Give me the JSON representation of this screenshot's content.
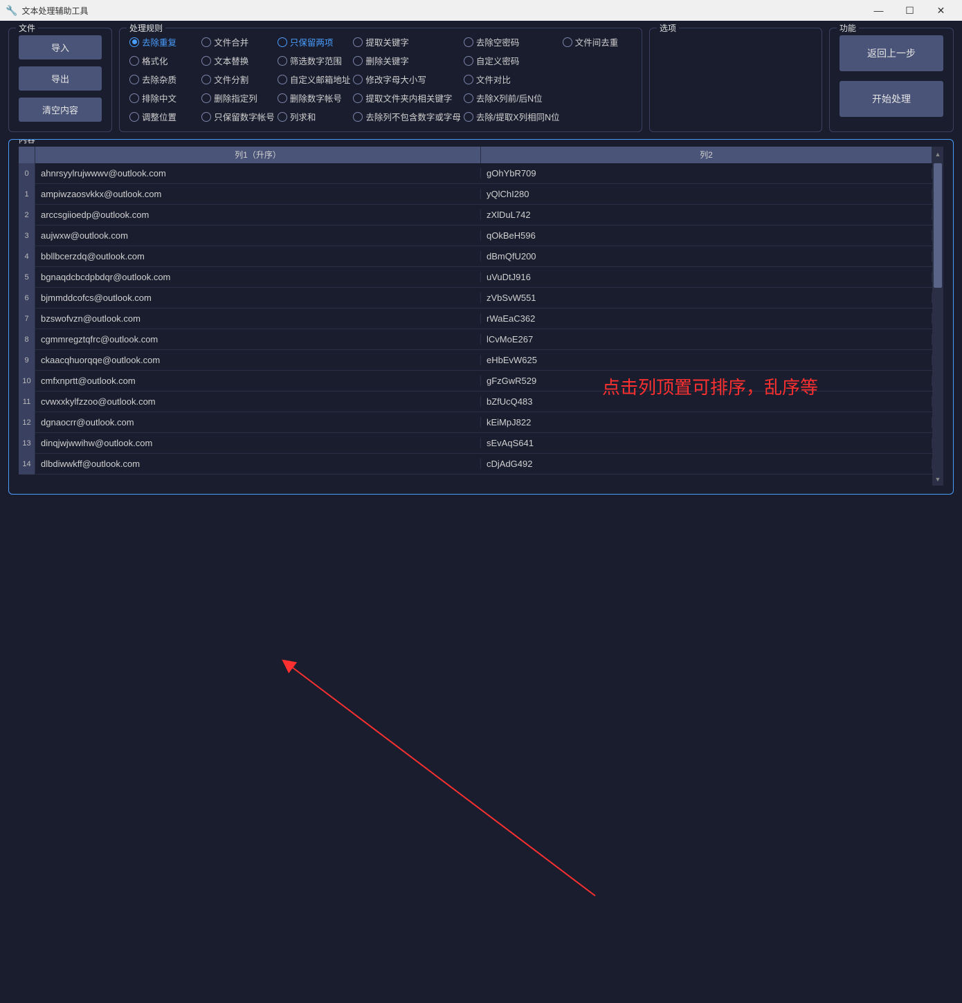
{
  "window": {
    "title": "文本处理辅助工具"
  },
  "file": {
    "title": "文件",
    "import": "导入",
    "export": "导出",
    "clear": "清空内容"
  },
  "rules": {
    "title": "处理规则",
    "options": [
      {
        "label": "去除重复",
        "selected": true
      },
      {
        "label": "文件合并"
      },
      {
        "label": "只保留两项",
        "highlight": true
      },
      {
        "label": "提取关键字"
      },
      {
        "label": "去除空密码"
      },
      {
        "label": "文件间去重"
      },
      {
        "label": "格式化"
      },
      {
        "label": "文本替换"
      },
      {
        "label": "筛选数字范围"
      },
      {
        "label": "删除关键字"
      },
      {
        "label": "自定义密码"
      },
      {
        "label": ""
      },
      {
        "label": "去除杂质"
      },
      {
        "label": "文件分割"
      },
      {
        "label": "自定义邮箱地址"
      },
      {
        "label": "修改字母大小写"
      },
      {
        "label": "文件对比"
      },
      {
        "label": ""
      },
      {
        "label": "排除中文"
      },
      {
        "label": "删除指定列"
      },
      {
        "label": "删除数字帐号"
      },
      {
        "label": "提取文件夹内相关键字"
      },
      {
        "label": "去除X列前/后N位"
      },
      {
        "label": ""
      },
      {
        "label": "调整位置"
      },
      {
        "label": "只保留数字帐号"
      },
      {
        "label": "列求和"
      },
      {
        "label": "去除列不包含数字或字母"
      },
      {
        "label": "去除/提取X列相同N位"
      },
      {
        "label": ""
      }
    ]
  },
  "options_group": {
    "title": "选项"
  },
  "func": {
    "title": "功能",
    "back": "返回上一步",
    "start": "开始处理"
  },
  "content": {
    "title": "内容",
    "col1": "列1（升序）",
    "col2": "列2",
    "rows": [
      {
        "c1": "ahnrsyylrujwwwv@outlook.com",
        "c2": "gOhYbR709"
      },
      {
        "c1": "ampiwzaosvkkx@outlook.com",
        "c2": "yQlChI280"
      },
      {
        "c1": "arccsgiioedp@outlook.com",
        "c2": "zXlDuL742"
      },
      {
        "c1": "aujwxw@outlook.com",
        "c2": "qOkBeH596"
      },
      {
        "c1": "bbllbcerzdq@outlook.com",
        "c2": "dBmQfU200"
      },
      {
        "c1": "bgnaqdcbcdpbdqr@outlook.com",
        "c2": "uVuDtJ916"
      },
      {
        "c1": "bjmmddcofcs@outlook.com",
        "c2": "zVbSvW551"
      },
      {
        "c1": "bzswofvzn@outlook.com",
        "c2": "rWaEaC362"
      },
      {
        "c1": "cgmmregztqfrc@outlook.com",
        "c2": "lCvMoE267"
      },
      {
        "c1": "ckaacqhuorqqe@outlook.com",
        "c2": "eHbEvW625"
      },
      {
        "c1": "cmfxnprtt@outlook.com",
        "c2": "gFzGwR529"
      },
      {
        "c1": "cvwxxkylfzzoo@outlook.com",
        "c2": "bZfUcQ483"
      },
      {
        "c1": "dgnaocrr@outlook.com",
        "c2": "kEiMpJ822"
      },
      {
        "c1": "dinqjwjwwihw@outlook.com",
        "c2": "sEvAqS641"
      },
      {
        "c1": "dlbdiwwkff@outlook.com",
        "c2": "cDjAdG492"
      }
    ]
  },
  "annotation": {
    "text": "点击列顶置可排序，乱序等"
  }
}
